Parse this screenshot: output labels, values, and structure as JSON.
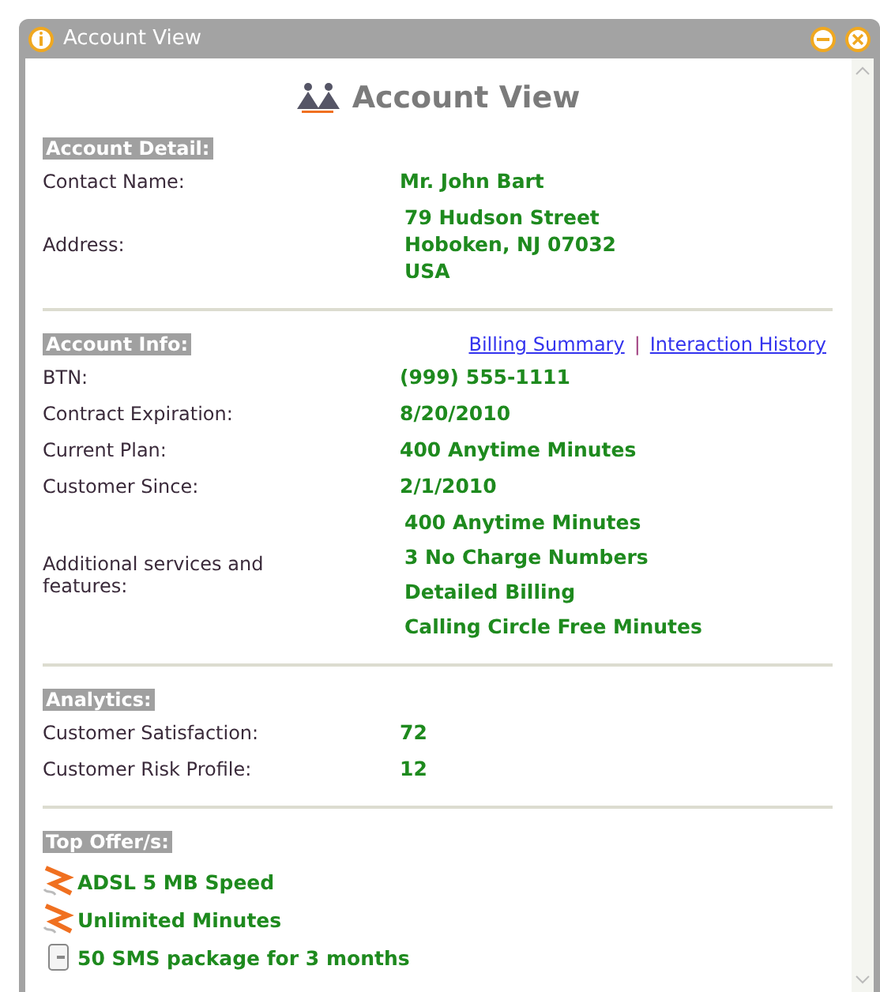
{
  "window": {
    "title": "Account View"
  },
  "heading": "Account View",
  "account_detail": {
    "title": "Account Detail:",
    "rows": [
      {
        "label": "Contact Name:",
        "values": [
          "Mr. John Bart"
        ]
      },
      {
        "label": "Address:",
        "values": [
          "79 Hudson Street",
          "Hoboken, NJ 07032",
          "USA"
        ]
      }
    ]
  },
  "account_info": {
    "title": "Account Info:",
    "links": [
      "Billing Summary",
      "Interaction History"
    ],
    "separator": "|",
    "rows": [
      {
        "label": "BTN:",
        "values": [
          "(999) 555-1111"
        ]
      },
      {
        "label": "Contract Expiration:",
        "values": [
          "8/20/2010"
        ]
      },
      {
        "label": "Current Plan:",
        "values": [
          "400 Anytime Minutes"
        ]
      },
      {
        "label": "Customer Since:",
        "values": [
          "2/1/2010"
        ]
      },
      {
        "label": "Additional services and features:",
        "values": [
          "400 Anytime Minutes",
          "3 No Charge Numbers",
          "Detailed Billing",
          "Calling Circle Free Minutes"
        ]
      }
    ]
  },
  "analytics": {
    "title": "Analytics:",
    "rows": [
      {
        "label": "Customer Satisfaction:",
        "values": [
          "72"
        ]
      },
      {
        "label": "Customer Risk Profile:",
        "values": [
          "12"
        ]
      }
    ]
  },
  "top_offers": {
    "title": "Top Offer/s:",
    "items": [
      {
        "kind": "plug",
        "label": "ADSL 5 MB Speed"
      },
      {
        "kind": "plug",
        "label": "Unlimited Minutes"
      },
      {
        "kind": "phone",
        "label": "50 SMS package for 3 months"
      }
    ]
  }
}
